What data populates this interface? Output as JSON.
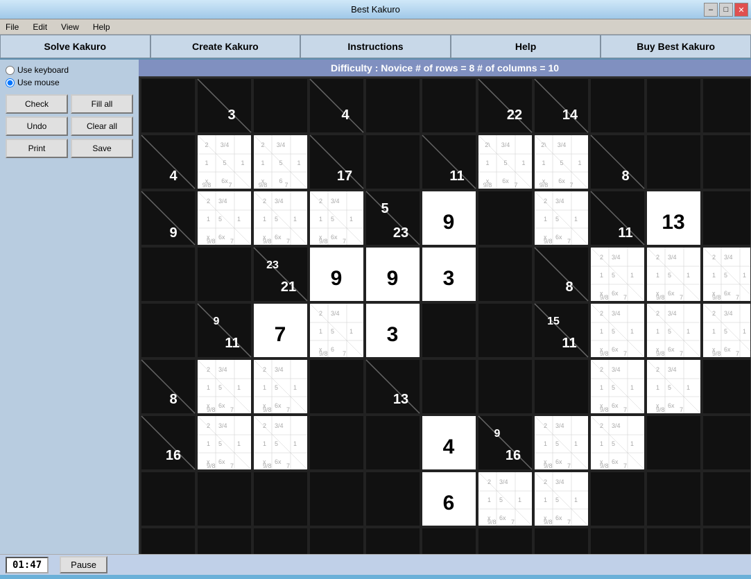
{
  "window": {
    "title": "Best Kakuro"
  },
  "titlebar": {
    "minimize": "–",
    "restore": "□",
    "close": "✕"
  },
  "menu": {
    "items": [
      "File",
      "Edit",
      "View",
      "Help"
    ]
  },
  "nav": {
    "buttons": [
      "Solve Kakuro",
      "Create Kakuro",
      "Instructions",
      "Help",
      "Buy Best Kakuro"
    ]
  },
  "controls": {
    "radio1": "Use keyboard",
    "radio2": "Use mouse",
    "check_label": "Check",
    "fill_label": "Fill all",
    "undo_label": "Undo",
    "clear_label": "Clear all",
    "print_label": "Print",
    "save_label": "Save"
  },
  "difficulty": {
    "text": "Difficulty : Novice    # of rows = 8    # of columns = 10"
  },
  "statusbar": {
    "timer": "01:47",
    "pause": "Pause"
  }
}
